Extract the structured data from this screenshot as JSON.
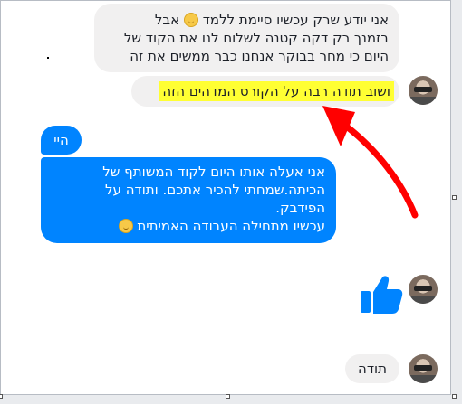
{
  "messages": {
    "m1_lines": [
      "אני יודע שרק עכשיו סיימת ללמד",
      "בזמנך רק דקה קטנה לשלוח לנו את הקוד של",
      "היום כי מחר בבוקר אנחנו כבר ממשים את זה"
    ],
    "m1_tail": "אבל",
    "m2": "ושוב תודה רבה על הקורס המדהים הזה",
    "m3": "היי",
    "m4_lines": [
      "אני אעלה אותו היום לקוד המשותף של",
      "הכיתה.שמחתי להכיר אתכם. ותודה על",
      "הפידבק.",
      "עכשיו מתחילה העבודה האמיתית"
    ],
    "m5": "תודה"
  },
  "colors": {
    "sent_bubble": "#0084ff",
    "received_bubble": "#f1f0f0",
    "highlight": "#ffff33",
    "arrow": "#ff0000",
    "like": "#0084ff"
  },
  "icons": {
    "smiley": "smiley-emoji-icon",
    "thumbs_up": "thumbs-up-icon",
    "annotation_arrow": "red-arrow-annotation"
  }
}
